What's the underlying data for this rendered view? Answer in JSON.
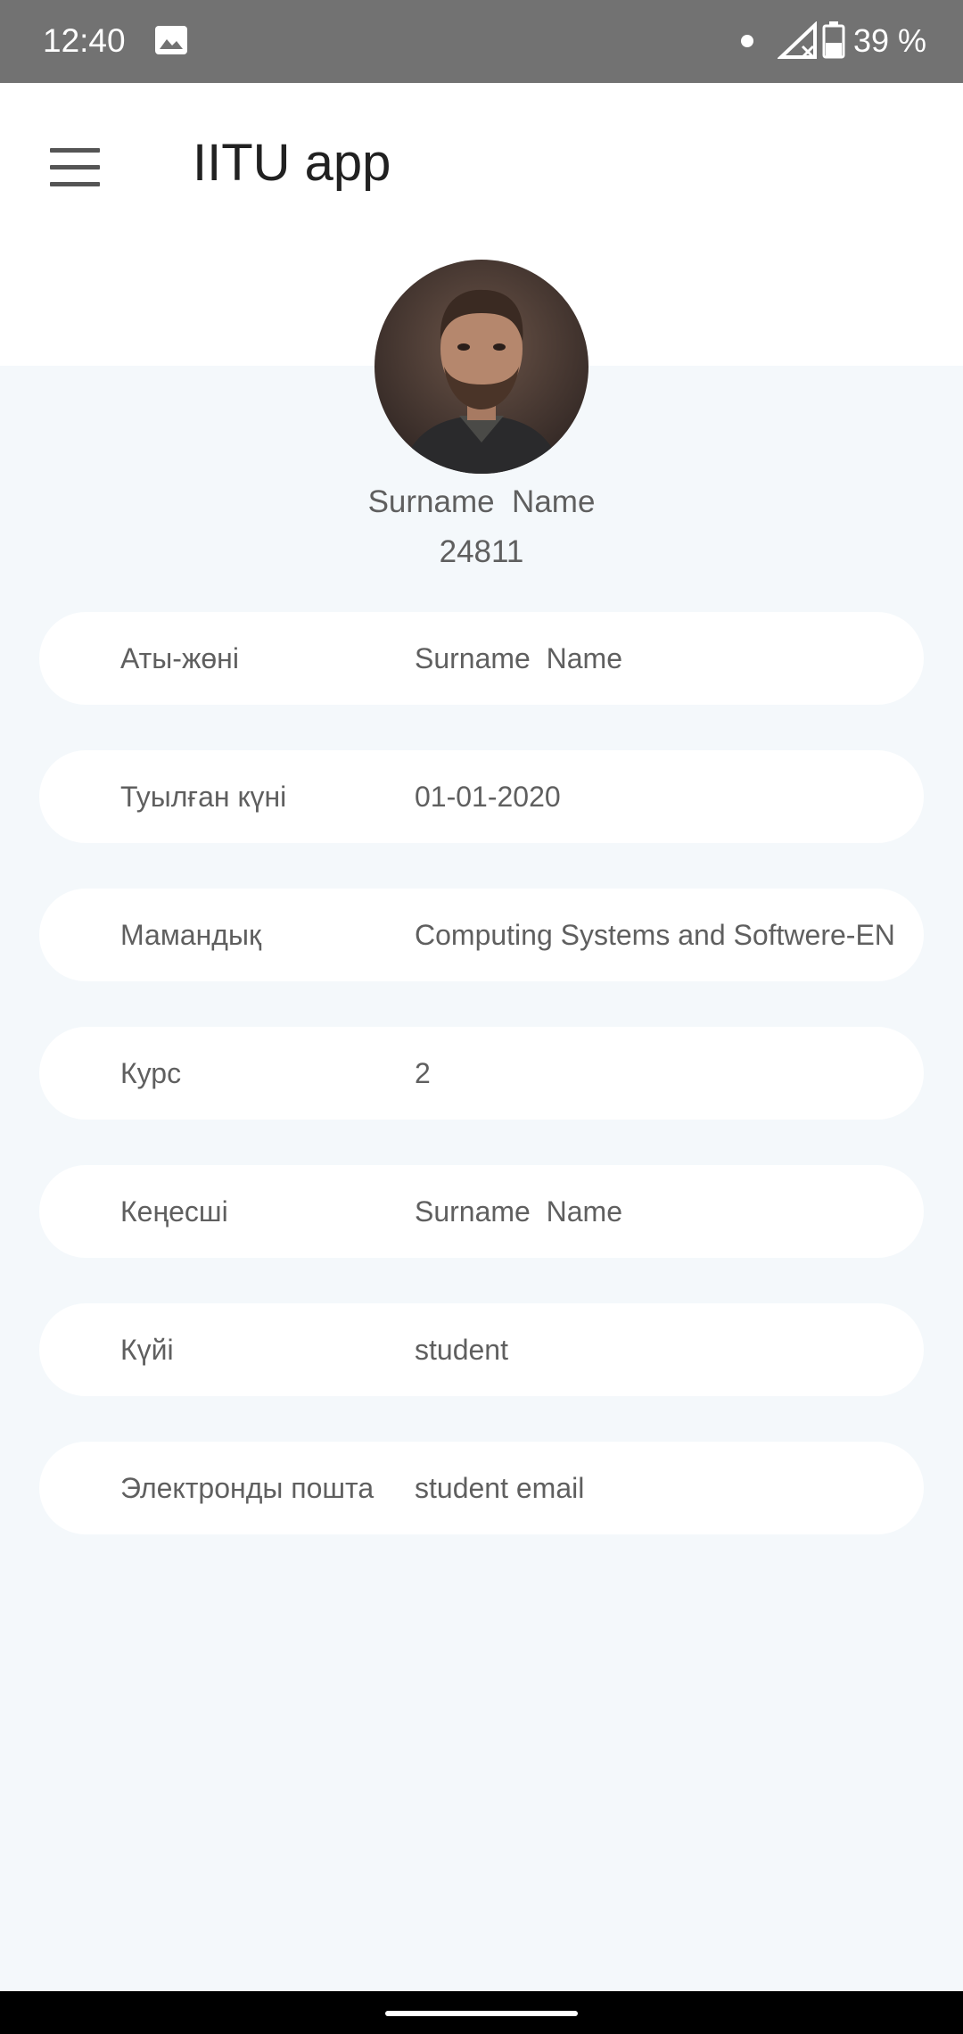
{
  "status_bar": {
    "time": "12:40",
    "battery_text": "39 %",
    "icons": [
      "image-icon",
      "dot-icon",
      "no-signal-icon",
      "battery-icon"
    ]
  },
  "app_bar": {
    "title": "IITU app",
    "menu_icon": "hamburger-menu-icon"
  },
  "profile": {
    "name": "Surname  Name",
    "id": "24811"
  },
  "info_rows": [
    {
      "label": "Аты-жөні",
      "value": "Surname  Name"
    },
    {
      "label": "Туылған күні",
      "value": "01-01-2020"
    },
    {
      "label": "Мамандық",
      "value": "Computing Systems and Softwere-EN"
    },
    {
      "label": "Курс",
      "value": "2"
    },
    {
      "label": "Кеңесші",
      "value": "Surname  Name"
    },
    {
      "label": "Күйі",
      "value": "student"
    },
    {
      "label": "Электронды пошта",
      "value": "student email"
    }
  ],
  "colors": {
    "status_bar": "#727272",
    "background": "#f4f8fb",
    "card": "#ffffff",
    "text": "#5f5f5f",
    "title": "#212121"
  }
}
